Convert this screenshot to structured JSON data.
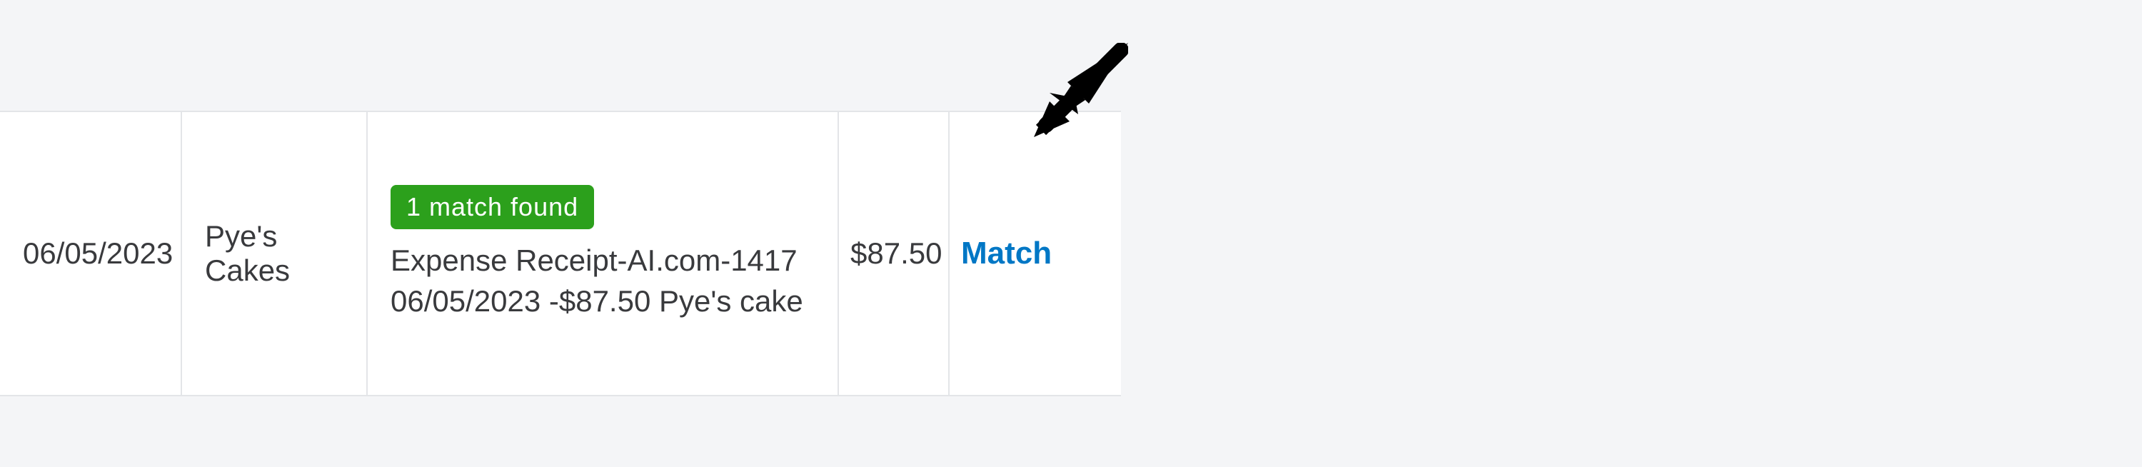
{
  "row": {
    "date": "06/05/2023",
    "payee": "Pye's Cakes",
    "badge": "1 match found",
    "description": "Expense Receipt-AI.com-1417 06/05/2023 -$87.50 Pye's cake",
    "amount": "$87.50",
    "action": "Match"
  },
  "colors": {
    "badge_bg": "#2ca01c",
    "link": "#0077c5"
  }
}
